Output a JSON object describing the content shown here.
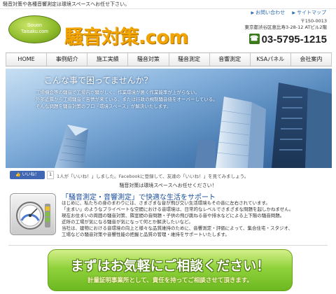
{
  "topbar": {
    "tagline": "騒音対策や各種音響測定は環境スペースへお任せ下さい。"
  },
  "logo": {
    "line1": "Souon",
    "line2": "Taisaku.com",
    "title": "騒音対策.com"
  },
  "util": {
    "contact": "お問い合わせ",
    "sitemap": "サイトマップ"
  },
  "address": {
    "postal": "〒150-0013",
    "street": "東京都渋谷区恵比寿3-28-12 ATビル2階"
  },
  "phone": "03-5795-1215",
  "nav": [
    "HOME",
    "事例紹介",
    "施工実績",
    "騒音対策",
    "騒音測定",
    "音響測定",
    "KSAパネル",
    "会社案内"
  ],
  "hero": {
    "title": "こんな事で困ってませんか？",
    "lines": [
      "工場機会等の騒音で工場内が騒がしく、作業環境が悪く作業能率が上がらない。",
      "外部近隣から工場騒音で苦情が来ている、または行政の規制騒音値をオーバーしている。",
      "そんな問題を騒音対策のプロ「環境スペース」が解決いたします。"
    ]
  },
  "facebook": {
    "like": "いいね！",
    "count": "1",
    "text": "1人が「いいね！」しました。Facebookに登録して、友達の「いいね！」を見てみましょう。"
  },
  "notice": "騒音対策は環境スペースへお任せください！",
  "intro": {
    "title": "「騒音測定・音響測定」で快適な生活をサポート",
    "lines": [
      "はじめに、私たちの身のまわりには、さまざまな音が飛び交い生活環境もその音に左右されています。",
      "「主まい」のようなプライベートな空間における音環境は、日常的なレベルでさまざまな問題を起しかねません。",
      "現在お住まいの周囲の騒音対策、隣室間の音問題・子供の飛び跳ねる音や排水などによる上下階の騒音問題。",
      "近所の工場が気になる騒音が気になって何とか解決したいなど。",
      "当社は、建物における音環境の向上と様々な品質維持のために、音響測定・評価によって、集合住宅・スタジオ、",
      "工場などの騒音対策や音響性能の把握と品質の管理・維持をサポートいたします。"
    ]
  },
  "cta": {
    "title": "まずはお気軽にご相談ください！",
    "subtitle": "計量証明事業所として、責任を持ってご相談させて頂きます。"
  },
  "colors": {
    "brand_orange": "#f2a400",
    "brand_green": "#8cba2a",
    "link_blue": "#2a6ab0",
    "cta_green": "#8fd13b"
  },
  "icons": [
    "arrow-icon",
    "phone-icon",
    "gauge-icon",
    "facebook-like-icon"
  ]
}
